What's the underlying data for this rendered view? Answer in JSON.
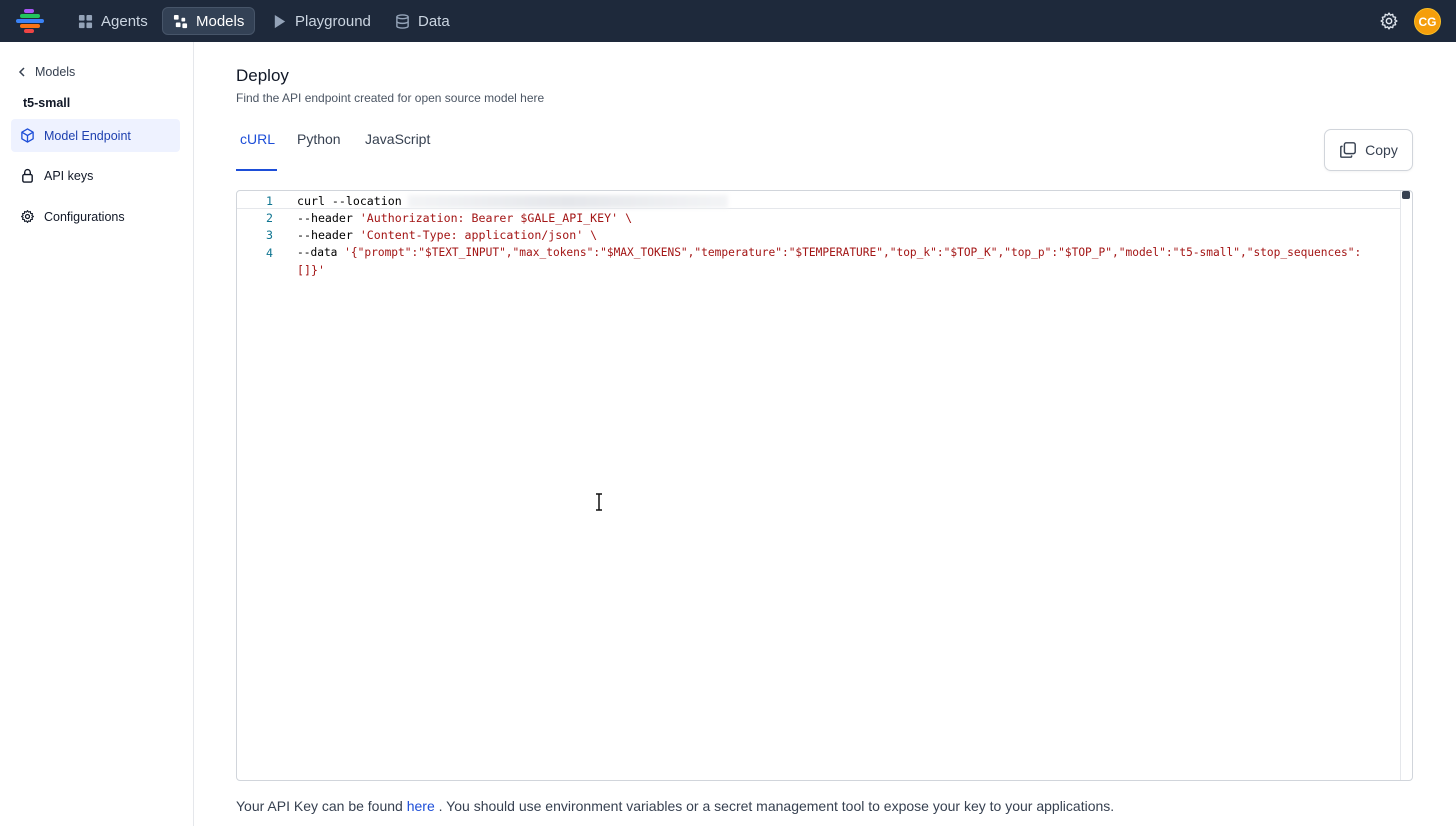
{
  "topbar": {
    "nav": [
      {
        "label": "Agents",
        "icon": "grid-icon"
      },
      {
        "label": "Models",
        "icon": "models-icon",
        "active": true
      },
      {
        "label": "Playground",
        "icon": "play-icon"
      },
      {
        "label": "Data",
        "icon": "database-icon"
      }
    ],
    "avatar_initials": "CG",
    "brand_colors": [
      "#22c55e",
      "#a855f7",
      "#f97316",
      "#3b82f6",
      "#ef4444"
    ],
    "avatar_color": "#f59e0b"
  },
  "sidebar": {
    "back_label": "Models",
    "model_name": "t5-small",
    "items": [
      {
        "label": "Model Endpoint",
        "icon": "cube-icon",
        "active": true
      },
      {
        "label": "API keys",
        "icon": "lock-icon"
      },
      {
        "label": "Configurations",
        "icon": "gear-icon"
      }
    ]
  },
  "main": {
    "title": "Deploy",
    "subtitle": "Find the API endpoint created for open source model here",
    "tabs": [
      "cURL",
      "Python",
      "JavaScript"
    ],
    "active_tab": "cURL",
    "copy_label": "Copy",
    "code": {
      "line_numbers": [
        "1",
        "2",
        "3",
        "4"
      ],
      "line1_cmd": "curl --location",
      "line2_flag": "--header ",
      "line2_str": "'Authorization: Bearer $GALE_API_KEY' \\",
      "line3_flag": "--header ",
      "line3_str": "'Content-Type: application/json' \\",
      "line4_flag": "--data ",
      "line4_str": "'{\"prompt\":\"$TEXT_INPUT\",\"max_tokens\":\"$MAX_TOKENS\",\"temperature\":\"$TEMPERATURE\",\"top_k\":\"$TOP_K\",\"top_p\":\"$TOP_P\",\"model\":\"t5-small\",\"stop_sequences\":",
      "line4_cont": "[]}'"
    },
    "footer_before": "Your API Key can be found ",
    "footer_link": "here",
    "footer_after": " . You should use environment variables or a secret management tool to expose your key to your applications."
  }
}
